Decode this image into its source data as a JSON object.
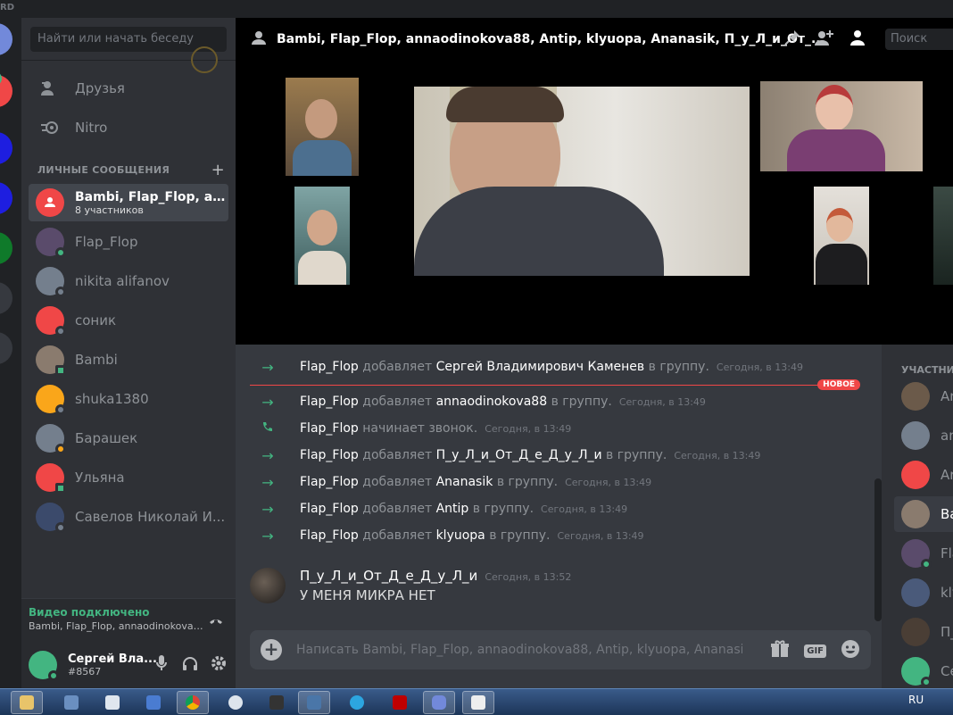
{
  "titlebar": {
    "brand": "RD"
  },
  "sidebar": {
    "search_placeholder": "Найти или начать беседу",
    "nav": [
      {
        "label": "Друзья",
        "icon": "friends-icon"
      },
      {
        "label": "Nitro",
        "icon": "nitro-icon"
      }
    ],
    "dm_header": "ЛИЧНЫЕ СООБЩЕНИЯ",
    "dms": [
      {
        "name": "Bambi, Flap_Flop, an...",
        "sub": "8 участников",
        "color": "#f04747",
        "status": ""
      },
      {
        "name": "Flap_Flop",
        "color": "#5a4b6b",
        "status": "#43b581"
      },
      {
        "name": "nikita alifanov",
        "color": "#747f8d",
        "status": "#747f8d"
      },
      {
        "name": "соник",
        "color": "#f04747",
        "status": "#747f8d"
      },
      {
        "name": "Bambi",
        "color": "#8a7b6e",
        "status": "#43b581"
      },
      {
        "name": "shuka1380",
        "color": "#faa61a",
        "status": "#747f8d"
      },
      {
        "name": "Барашек",
        "color": "#747f8d",
        "status": "#faa61a"
      },
      {
        "name": "Ульяна",
        "color": "#f04747",
        "status": "#43b581"
      },
      {
        "name": "Савелов Николай И...",
        "color": "#3b4a6b",
        "status": "#747f8d"
      }
    ],
    "voice": {
      "status": "Видео подключено",
      "channel": "Bambi, Flap_Flop, annaodinokova88,..."
    },
    "user": {
      "name": "Сергей Вла...",
      "tag": "#8567"
    }
  },
  "header": {
    "title": "Bambi, Flap_Flop, annaodinokova88, Antip, klyuopa, Ananasik, П_у_Л_и_От_...",
    "search_placeholder": "Поиск"
  },
  "chat": {
    "new_label": "НОВОЕ",
    "system_messages": [
      {
        "user": "Flap_Flop",
        "verb": "добавляет",
        "target": "Сергей Владимирович Каменев",
        "tail": "в группу.",
        "time": "Сегодня, в 13:49",
        "kind": "add"
      },
      {
        "user": "Flap_Flop",
        "verb": "добавляет",
        "target": "annaodinokova88",
        "tail": "в группу.",
        "time": "Сегодня, в 13:49",
        "kind": "add"
      },
      {
        "user": "Flap_Flop",
        "verb": "начинает звонок.",
        "target": "",
        "tail": "",
        "time": "Сегодня, в 13:49",
        "kind": "call"
      },
      {
        "user": "Flap_Flop",
        "verb": "добавляет",
        "target": "П_у_Л_и_От_Д_е_Д_у_Л_и",
        "tail": "в группу.",
        "time": "Сегодня, в 13:49",
        "kind": "add"
      },
      {
        "user": "Flap_Flop",
        "verb": "добавляет",
        "target": "Ananasik",
        "tail": "в группу.",
        "time": "Сегодня, в 13:49",
        "kind": "add"
      },
      {
        "user": "Flap_Flop",
        "verb": "добавляет",
        "target": "Antip",
        "tail": "в группу.",
        "time": "Сегодня, в 13:49",
        "kind": "add"
      },
      {
        "user": "Flap_Flop",
        "verb": "добавляет",
        "target": "klyuopa",
        "tail": "в группу.",
        "time": "Сегодня, в 13:49",
        "kind": "add"
      }
    ],
    "message": {
      "author": "П_у_Л_и_От_Д_е_Д_у_Л_и",
      "time": "Сегодня, в 13:52",
      "text": "У МЕНЯ МИКРА НЕТ"
    },
    "composer_placeholder": "Написать Bambi, Flap_Flop, annaodinokova88, Antip, klyuopa, Ananasik, ..."
  },
  "members": {
    "header": "УЧАСТНИКИ",
    "items": [
      {
        "name": "An",
        "color": "#6b5a4a",
        "status": ""
      },
      {
        "name": "an",
        "color": "#747f8d",
        "status": ""
      },
      {
        "name": "Ar",
        "color": "#f04747",
        "status": ""
      },
      {
        "name": "Ba",
        "color": "#8a7b6e",
        "status": ""
      },
      {
        "name": "Fla",
        "color": "#5a4b6b",
        "status": "#43b581"
      },
      {
        "name": "kly",
        "color": "#4a5a7a",
        "status": ""
      },
      {
        "name": "П_",
        "color": "#4a3e35",
        "status": ""
      },
      {
        "name": "Се",
        "color": "#43b581",
        "status": "#43b581"
      }
    ]
  },
  "taskbar": {
    "lang": "RU"
  }
}
